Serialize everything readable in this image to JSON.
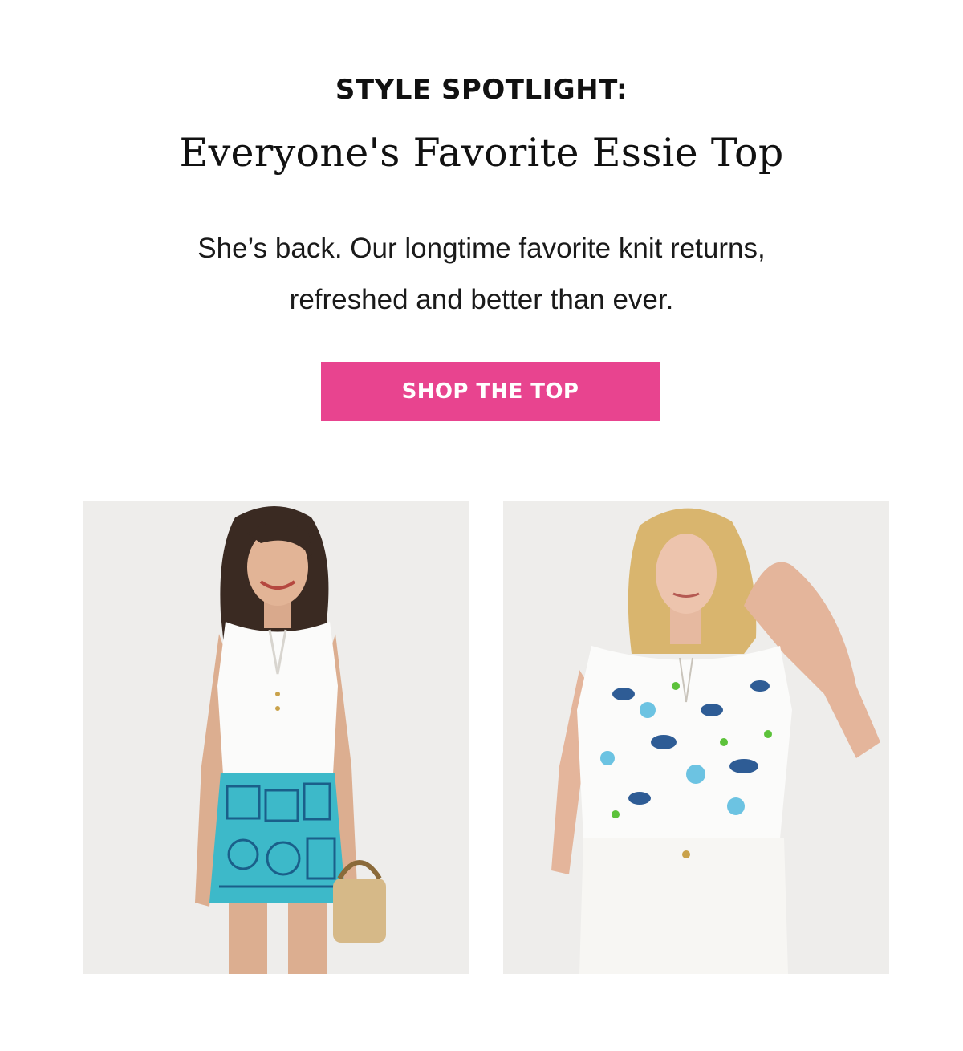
{
  "spotlight": {
    "eyebrow": "STYLE SPOTLIGHT:",
    "headline": "Everyone's Favorite Essie Top",
    "body_line_1": "She’s back. Our longtime favorite knit returns,",
    "body_line_2": "refreshed and better than ever.",
    "cta_label": "SHOP THE TOP"
  },
  "colors": {
    "cta_background": "#e8448f",
    "cta_text": "#ffffff",
    "text": "#111111",
    "photo_background": "#eeedeb"
  },
  "images": [
    {
      "name": "product-photo-white-essie-top",
      "description_icon": "model-photo"
    },
    {
      "name": "product-photo-floral-essie-top",
      "description_icon": "model-photo"
    }
  ]
}
